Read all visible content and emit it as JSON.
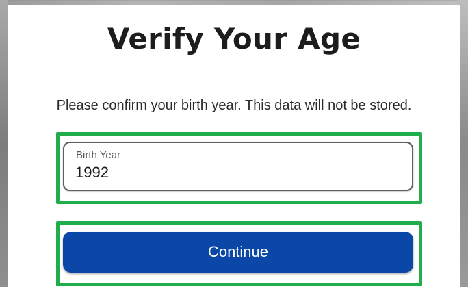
{
  "dialog": {
    "title": "Verify Your Age",
    "subtitle": "Please confirm your birth year. This data will not be stored."
  },
  "birth_year_field": {
    "label": "Birth Year",
    "value": "1992"
  },
  "continue_button": {
    "label": "Continue"
  },
  "colors": {
    "button_background": "#0a47a6",
    "highlight_border": "#1fae4b"
  }
}
